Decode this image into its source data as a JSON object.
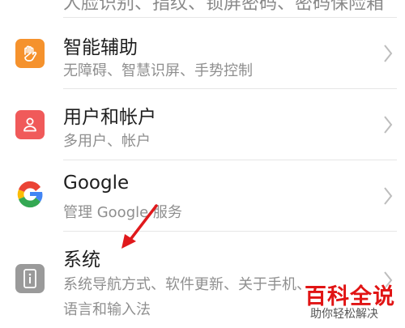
{
  "top_cutoff_text": "人脸识别、指纹、锁屏密码、密码保险箱",
  "settings_items": [
    {
      "title": "智能辅助",
      "subtitle": "无障碍、智慧识屏、手势控制",
      "icon": "hand-icon",
      "color": "#f5922d"
    },
    {
      "title": "用户和帐户",
      "subtitle": "多用户、帐户",
      "icon": "user-icon",
      "color": "#f05a5a"
    },
    {
      "title": "Google",
      "subtitle": "管理 Google 服务",
      "icon": "google-icon",
      "color": "#4285f4"
    },
    {
      "title": "系统",
      "subtitle_line1": "系统导航方式、软件更新、关于手机、",
      "subtitle_line2": "语言和输入法",
      "icon": "system-info-icon",
      "color": "#9a9a9a"
    }
  ],
  "watermark": {
    "main": "百科全说",
    "sub": "助你轻松解决"
  },
  "annotation_color": "#e0191c"
}
